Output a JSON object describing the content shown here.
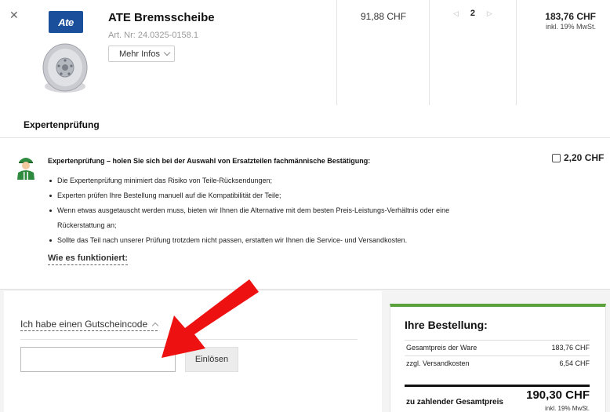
{
  "product": {
    "brand_logo_text": "Ate",
    "title": "ATE Bremsscheibe",
    "article_number": "Art. Nr: 24.0325-0158.1",
    "more_info_label": "Mehr Infos",
    "unit_price": "91,88 CHF",
    "quantity": "2",
    "total_price": "183,76 CHF",
    "total_vat_note": "inkl. 19% MwSt."
  },
  "expert_check": {
    "heading": "Expertenprüfung",
    "intro": "Expertenprüfung – holen Sie sich bei der Auswahl von Ersatzteilen fachmännische Bestätigung:",
    "points": [
      "Die Expertenprüfung minimiert das Risiko von Teile-Rücksendungen;",
      "Experten prüfen Ihre Bestellung manuell auf die Kompatibilität der Teile;",
      "Wenn etwas ausgetauscht werden muss, bieten wir Ihnen die Alternative mit dem besten Preis-Leistungs-Verhältnis oder eine",
      "Rückerstattung an;",
      "Sollte das Teil nach unserer Prüfung trotzdem nicht passen, erstatten wir Ihnen die Service- und Versandkosten."
    ],
    "how_it_works_link": "Wie es funktioniert:",
    "option_price": "2,20 CHF",
    "option_checked": false
  },
  "coupon": {
    "toggle_label": "Ich habe einen Gutscheincode",
    "input_value": "",
    "redeem_label": "Einlösen"
  },
  "order_summary": {
    "title": "Ihre Bestellung:",
    "goods_label": "Gesamtpreis der Ware",
    "goods_value": "183,76 CHF",
    "shipping_label": "zzgl. Versandkosten",
    "shipping_value": "6,54 CHF",
    "total_label": "zu zahlender Gesamtpreis",
    "total_value": "190,30 CHF",
    "total_vat_note": "inkl. 19% MwSt."
  },
  "icons": {
    "remove": "close-icon",
    "mechanic": "mechanic-icon",
    "annotation": "red-arrow-icon"
  },
  "colors": {
    "brand_blue": "#1a4f9c",
    "accent_green": "#5aa13c",
    "annotation_red": "#ee1111"
  }
}
